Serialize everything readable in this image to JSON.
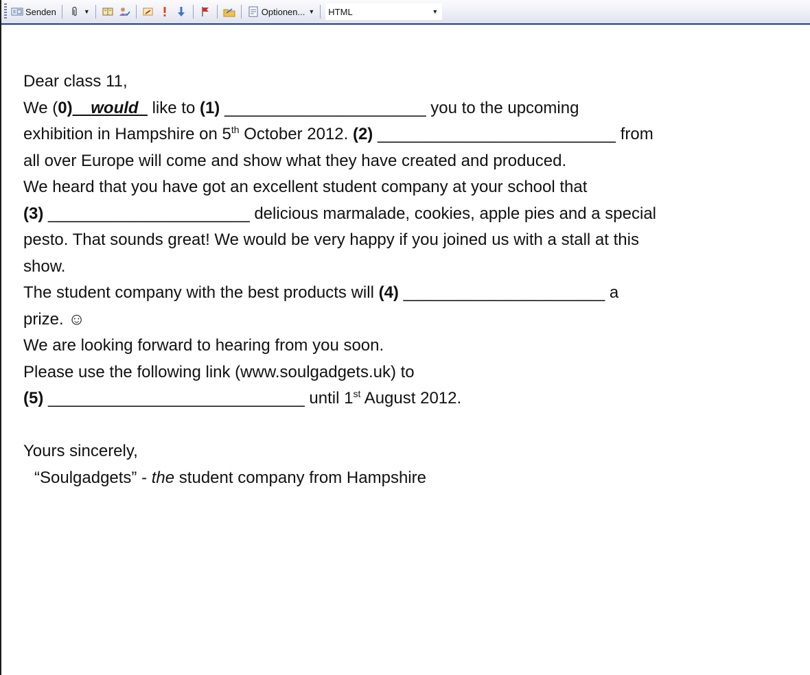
{
  "toolbar": {
    "send_label": "Senden",
    "options_label": "Optionen...",
    "format_value": "HTML",
    "icons": [
      "send-icon",
      "attach-icon",
      "address-book-icon",
      "check-names-icon",
      "signature-icon",
      "high-importance-icon",
      "low-importance-icon",
      "follow-up-flag-icon",
      "bcc-icon",
      "options-icon"
    ]
  },
  "letter": {
    "greeting": "Dear class 11,",
    "l1_a": "We (",
    "l1_n0": "0)",
    "l1_ans": "  _would  ",
    "l1_b": " like to ",
    "l1_n1": "(1)",
    "l1_c": " ______________________ you to the upcoming",
    "l2_a": "exhibition in Hampshire on 5",
    "l2_sup": "th",
    "l2_b": " October 2012. ",
    "l2_n2": "(2)",
    "l2_c": " __________________________ from",
    "l3": "all over Europe will come and show what they have created and produced.",
    "l4": "We heard that you have got an excellent student company at your school that",
    "l5_n3": "(3)",
    "l5_a": " ______________________ delicious marmalade, cookies, apple pies and a special",
    "l6": "pesto. That sounds great! We would be very happy if you joined us with a stall at this",
    "l7": "show.",
    "l8_a": "The student company with the best products will ",
    "l8_n4": "(4)",
    "l8_b": " ______________________ a",
    "l9": "prize. ☺",
    "l10": "We are looking forward to hearing from you soon.",
    "l11": "Please use the following link (www.soulgadgets.uk) to",
    "l12_n5": "(5)",
    "l12_a": " ____________________________ until 1",
    "l12_sup": "st",
    "l12_b": " August 2012.",
    "closing": "Yours sincerely,",
    "sig_a": "“Soulgadgets” - ",
    "sig_em": "the",
    "sig_b": " student company from Hampshire"
  }
}
